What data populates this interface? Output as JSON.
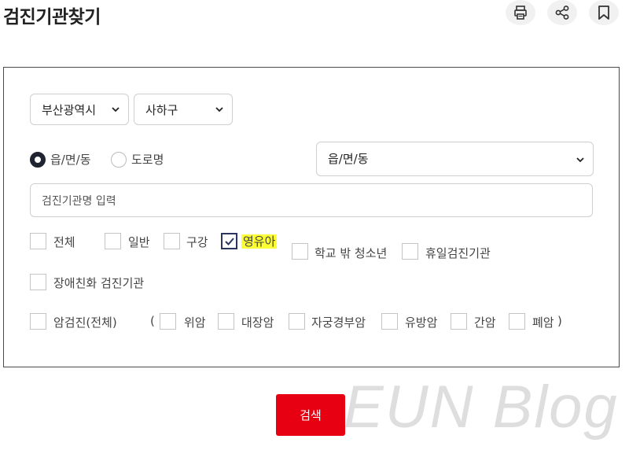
{
  "page": {
    "title": "검진기관찾기"
  },
  "toolbar": {
    "print_icon": "print-icon",
    "share_icon": "share-icon",
    "bookmark_icon": "bookmark-icon"
  },
  "region": {
    "city": "부산광역시",
    "district": "사하구"
  },
  "address_type": {
    "options": [
      "읍/면/동",
      "도로명"
    ],
    "selected": "읍/면/동",
    "dong_select": "읍/면/동"
  },
  "search_input": {
    "placeholder": "검진기관명 입력",
    "value": ""
  },
  "checkboxes": {
    "all": {
      "label": "전체",
      "checked": false
    },
    "general": {
      "label": "일반",
      "checked": false
    },
    "oral": {
      "label": "구강",
      "checked": false
    },
    "infant": {
      "label": "영유아",
      "checked": true
    },
    "youth": {
      "label": "학교 밖 청소년",
      "checked": false
    },
    "holiday": {
      "label": "휴일검진기관",
      "checked": false
    },
    "disabled": {
      "label": "장애친화 검진기관",
      "checked": false
    },
    "cancer_all": {
      "label": "암검진(전체)",
      "checked": false
    },
    "paren_open": "(",
    "stomach": {
      "label": "위암",
      "checked": false
    },
    "colon": {
      "label": "대장암",
      "checked": false
    },
    "cervical": {
      "label": "자궁경부암",
      "checked": false
    },
    "breast": {
      "label": "유방암",
      "checked": false
    },
    "liver": {
      "label": "간암",
      "checked": false
    },
    "lung": {
      "label": "폐암",
      "checked": false
    },
    "paren_close": ")"
  },
  "search_button": {
    "label": "검색",
    "color": "#e60012"
  },
  "watermark": "EUN Blog"
}
